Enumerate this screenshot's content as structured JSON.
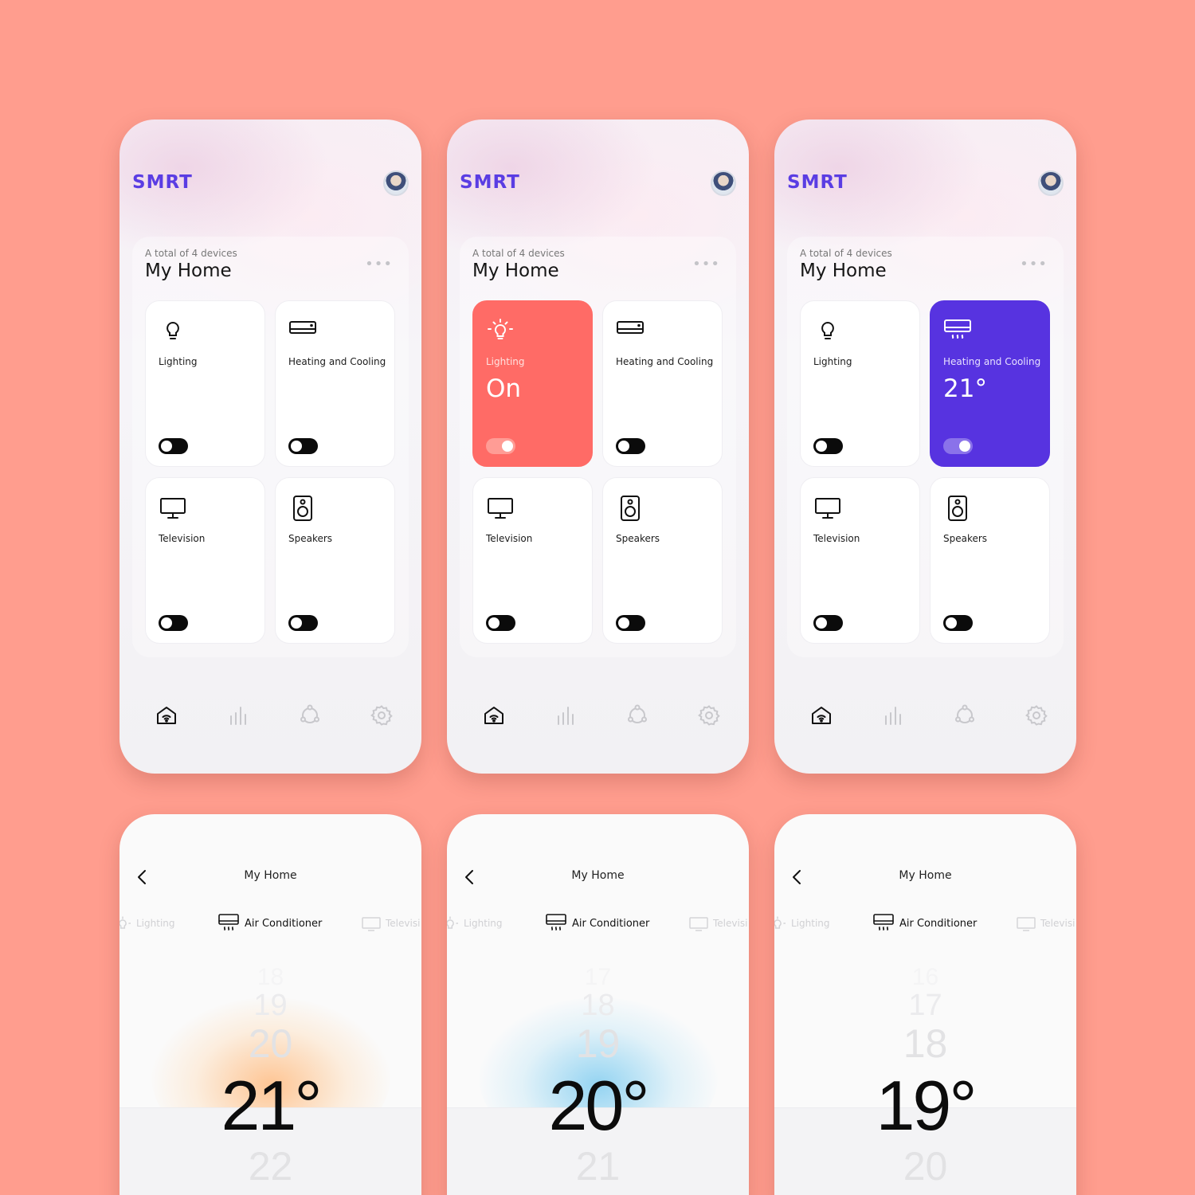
{
  "logo": "SMRT",
  "home": {
    "subtitle": "A total of 4 devices",
    "title": "My Home",
    "more_label": "•••",
    "devices": {
      "lighting": "Lighting",
      "heating": "Heating and Cooling",
      "television": "Television",
      "speakers": "Speakers"
    },
    "lighting_state": "On",
    "heating_value": "21°"
  },
  "temp_screen": {
    "title": "My Home",
    "left_device": "Lighting",
    "center_device": "Air Conditioner",
    "right_device": "Televisi",
    "screens": [
      {
        "above3": "18",
        "above2": "19",
        "above1": "20",
        "current": "21°",
        "below": "22",
        "glow": "warm"
      },
      {
        "above3": "17",
        "above2": "18",
        "above1": "19",
        "current": "20°",
        "below": "21",
        "glow": "cool"
      },
      {
        "above3": "16",
        "above2": "17",
        "above1": "18",
        "current": "19°",
        "below": "20",
        "glow": "none"
      }
    ]
  },
  "colors": {
    "background": "#ff9d8e",
    "brand": "#5a3de3",
    "lighting_active": "#ff6b66",
    "heating_active": "#5733e0"
  },
  "nav_icons": [
    "home-wifi-icon",
    "stats-icon",
    "devices-icon",
    "settings-icon"
  ]
}
